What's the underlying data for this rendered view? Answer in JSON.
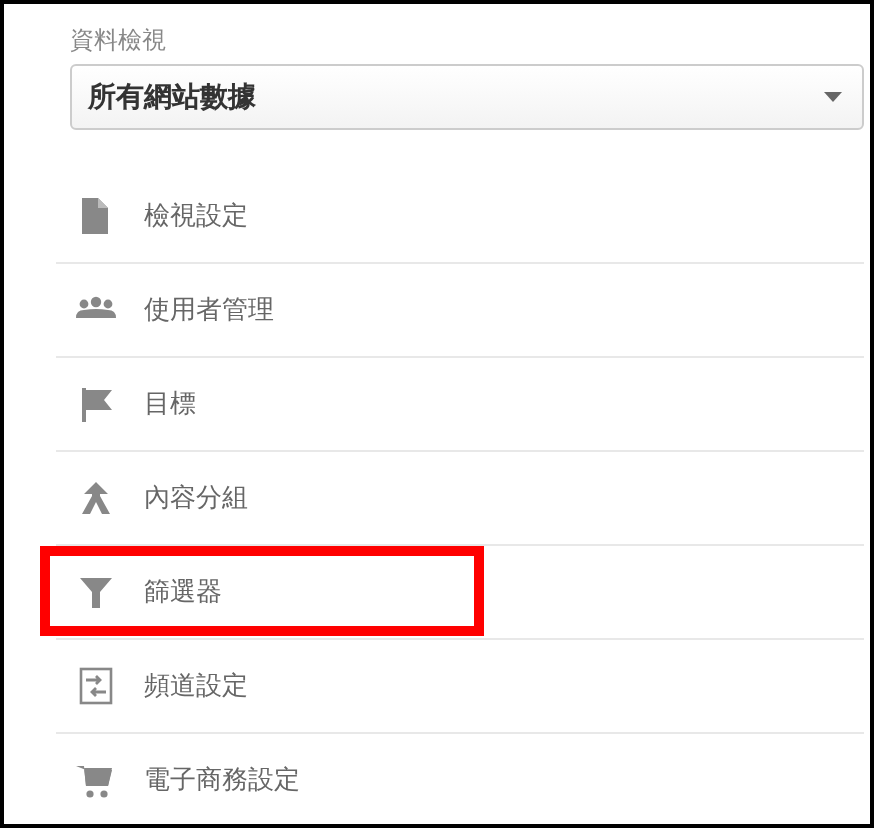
{
  "view_label": "資料檢視",
  "view_select": {
    "value": "所有網站數據"
  },
  "items": [
    {
      "label": "檢視設定",
      "highlighted": false
    },
    {
      "label": "使用者管理",
      "highlighted": false
    },
    {
      "label": "目標",
      "highlighted": false
    },
    {
      "label": "內容分組",
      "highlighted": false
    },
    {
      "label": "篩選器",
      "highlighted": true
    },
    {
      "label": "頻道設定",
      "highlighted": false
    },
    {
      "label": "電子商務設定",
      "highlighted": false
    }
  ]
}
